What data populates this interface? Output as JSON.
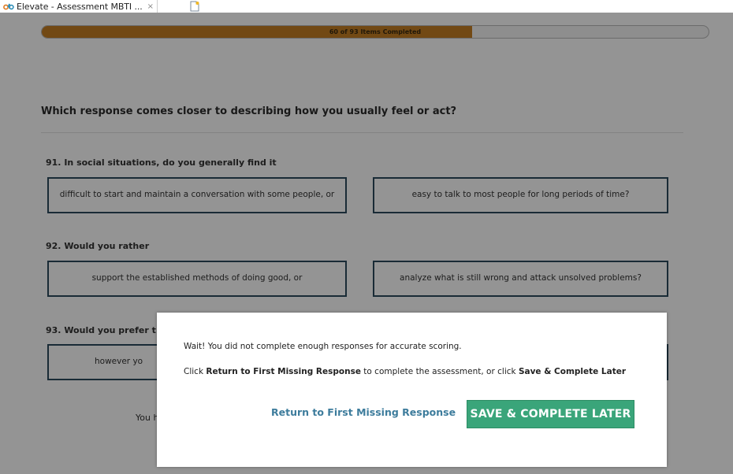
{
  "browser": {
    "tab_title": "Elevate - Assessment MBTI ...",
    "close_glyph": "×",
    "logo_icon": "elevate-logo-icon",
    "new_tab_icon": "new-tab-icon"
  },
  "progress": {
    "label": "60 of 93 Items Completed",
    "completed": 60,
    "total": 93,
    "fill_color": "#c47f24"
  },
  "prompt": "Which response comes closer to describing how you usually feel or act?",
  "questions": [
    {
      "label": "91. In social situations, do you generally find it",
      "option_a": "difficult to start and maintain a conversation with some people, or",
      "option_b": "easy to talk to most people for long periods of time?"
    },
    {
      "label": "92. Would you rather",
      "option_a": "support the established methods of doing good, or",
      "option_b": "analyze what is still wrong and attack unsolved problems?"
    },
    {
      "label": "93. Would you prefer t",
      "option_a": "however yo"
    }
  ],
  "footer_fragment": "You h",
  "modal": {
    "message": "Wait! You did not complete enough responses for accurate scoring.",
    "instruction_pre": "Click ",
    "instruction_link1": "Return to First Missing Response",
    "instruction_mid": " to complete the assessment, or click ",
    "instruction_link2": "Save & Complete Later",
    "return_button": "Return to First Missing Response",
    "save_button": "SAVE & COMPLETE LATER",
    "save_button_color": "#3aa57a",
    "link_color": "#3d7c9c"
  }
}
